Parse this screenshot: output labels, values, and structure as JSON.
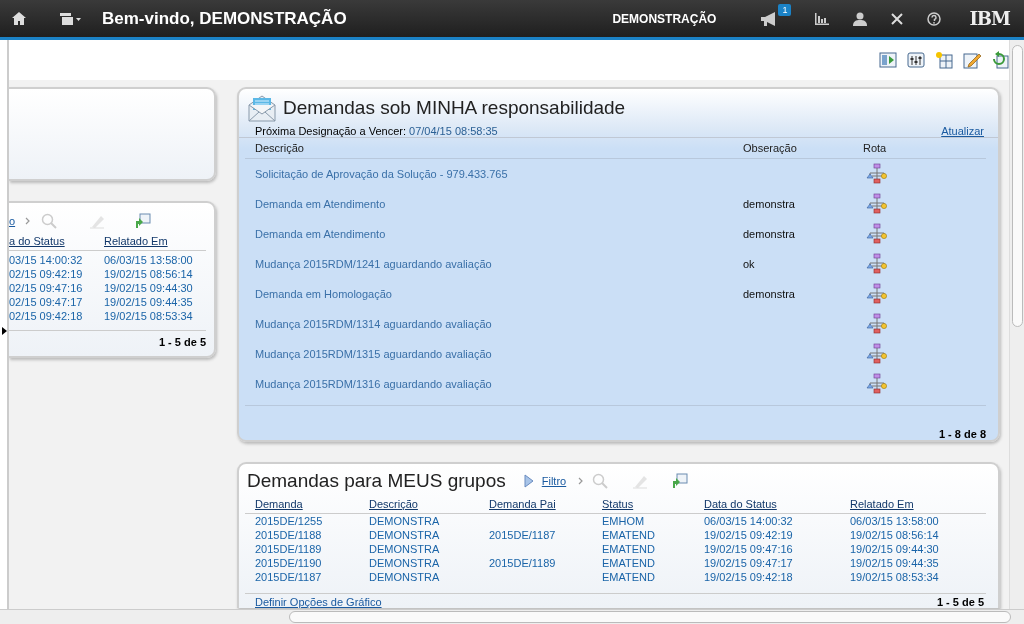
{
  "top_bar": {
    "title": "Bem-vindo, DEMONSTRAÇÃO",
    "user": "DEMONSTRAÇÃO",
    "notification_count": "1",
    "logo": "IBM"
  },
  "left_panel": {
    "toolbar_link": "o",
    "columns": [
      "a do Status",
      "Relatado Em"
    ],
    "rows": [
      [
        "03/15 14:00:32",
        "06/03/15 13:58:00"
      ],
      [
        "02/15 09:42:19",
        "19/02/15 08:56:14"
      ],
      [
        "02/15 09:47:16",
        "19/02/15 09:44:30"
      ],
      [
        "02/15 09:47:17",
        "19/02/15 09:44:35"
      ],
      [
        "02/15 09:42:18",
        "19/02/15 08:53:34"
      ]
    ],
    "pagination": "1 - 5 de 5"
  },
  "assignments": {
    "title": "Demandas sob MINHA responsabilidade",
    "next_due_label": "Próxima Designação a Vencer:",
    "next_due_value": "07/04/15 08:58:35",
    "refresh_link": "Atualizar",
    "columns": [
      "Descrição",
      "Obseração",
      "Rota"
    ],
    "rows": [
      {
        "description": "Solicitação de Aprovação da Solução - 979.433.765"
      },
      {
        "description": "Demanda em Atendimento",
        "note": "demonstra"
      },
      {
        "description": "Demanda em Atendimento",
        "note": "demonstra"
      },
      {
        "description": "Mudança 2015RDM/1241 aguardando avaliação",
        "note": "ok"
      },
      {
        "description": "Demanda em Homologação",
        "note": "demonstra"
      },
      {
        "description": "Mudança 2015RDM/1314 aguardando avaliação"
      },
      {
        "description": "Mudança 2015RDM/1315 aguardando avaliação"
      },
      {
        "description": "Mudança 2015RDM/1316 aguardando avaliação"
      }
    ],
    "pagination": "1 - 8 de 8"
  },
  "groups": {
    "title": "Demandas para MEUS grupos",
    "filter_link": "Filtro",
    "columns": [
      "Demanda",
      "Descrição",
      "Demanda Pai",
      "Status",
      "Data do Status",
      "Relatado Em"
    ],
    "rows": [
      {
        "demand": "2015DE/1255",
        "description": "DEMONSTRA",
        "status": "EMHOM",
        "status_date": "06/03/15 14:00:32",
        "reported": "06/03/15 13:58:00"
      },
      {
        "demand": "2015DE/1188",
        "description": "DEMONSTRA",
        "parent": "2015DE/1187",
        "status": "EMATEND",
        "status_date": "19/02/15 09:42:19",
        "reported": "19/02/15 08:56:14"
      },
      {
        "demand": "2015DE/1189",
        "description": "DEMONSTRA",
        "status": "EMATEND",
        "status_date": "19/02/15 09:47:16",
        "reported": "19/02/15 09:44:30"
      },
      {
        "demand": "2015DE/1190",
        "description": "DEMONSTRA",
        "parent": "2015DE/1189",
        "status": "EMATEND",
        "status_date": "19/02/15 09:47:17",
        "reported": "19/02/15 09:44:35"
      },
      {
        "demand": "2015DE/1187",
        "description": "DEMONSTRA",
        "status": "EMATEND",
        "status_date": "19/02/15 09:42:18",
        "reported": "19/02/15 08:53:34"
      }
    ],
    "chart_options_link": "Definir Opções de Gráfico",
    "pagination": "1 - 5 de 5"
  }
}
